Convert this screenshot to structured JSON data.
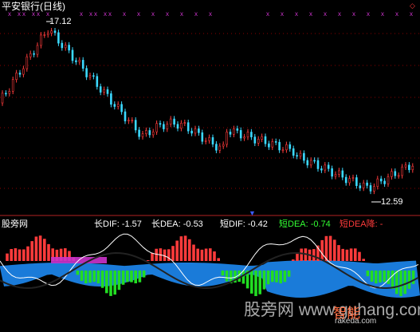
{
  "window": {
    "title": "平安银行(日线)"
  },
  "price_panel": {
    "high_label": "17.12",
    "low_label": "12.59"
  },
  "indicator_panel": {
    "name": "股旁网",
    "labels": [
      {
        "text": "长DIF: -1.57",
        "color": "#ffffff"
      },
      {
        "text": "长DEA: -0.53",
        "color": "#ffffff"
      },
      {
        "text": "短DIF: -0.42",
        "color": "#ffffff"
      },
      {
        "text": "短DEA: -0.74",
        "color": "#33ff33"
      },
      {
        "text": "短DEA降: -",
        "color": "#ff3b3b"
      }
    ]
  },
  "watermark": {
    "text": "股旁网 www.guhang.com",
    "logo": "智能",
    "sub": "rakeda.com"
  },
  "colors": {
    "up": "#ff3b3b",
    "down": "#3bd9ff",
    "grid": "#8b0000",
    "signal": "#cc33cc",
    "green_bar": "#22dd22",
    "blue_area": "#1e90ff",
    "magenta": "#cc33cc"
  },
  "chart_data": [
    {
      "type": "candlestick",
      "title": "平安银行(日线)",
      "annotations": [
        {
          "text": "17.12",
          "kind": "high"
        },
        {
          "text": "12.59",
          "kind": "low"
        }
      ],
      "y_range": [
        12.4,
        17.3
      ]
    },
    {
      "type": "bar",
      "title": "股旁网",
      "series": [
        {
          "name": "长DIF",
          "last_value": -1.57
        },
        {
          "name": "长DEA",
          "last_value": -0.53
        },
        {
          "name": "短DIF",
          "last_value": -0.42
        },
        {
          "name": "短DEA",
          "last_value": -0.74
        }
      ]
    }
  ]
}
